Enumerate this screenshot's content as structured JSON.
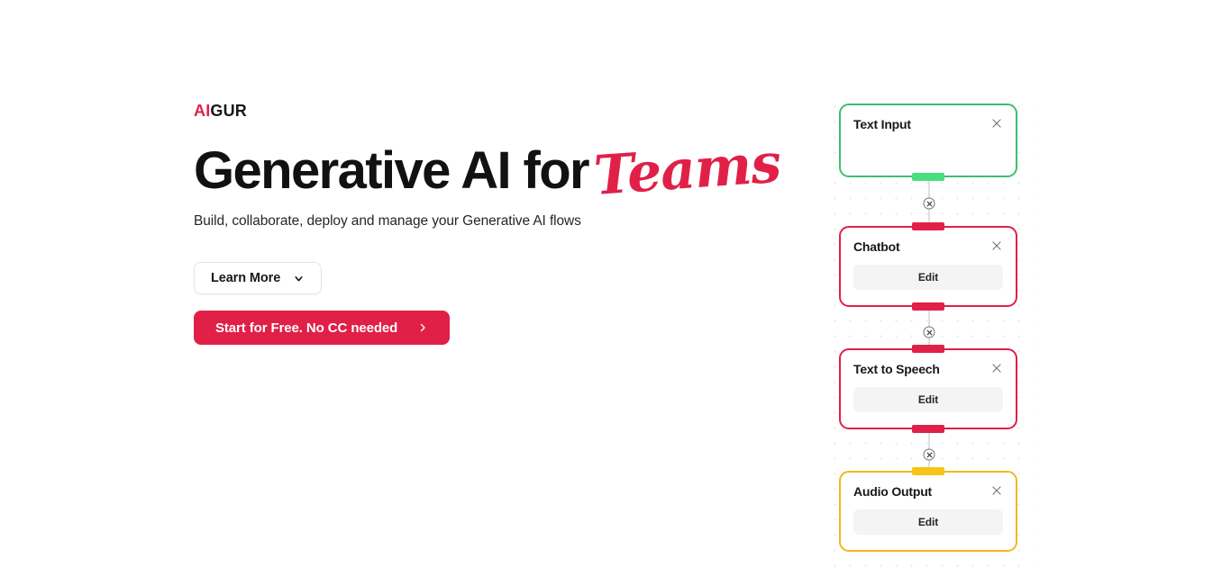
{
  "brand": {
    "logo_ai": "AI",
    "logo_gur": "GUR",
    "accent_color": "#E12048",
    "text_color": "#18181B"
  },
  "hero": {
    "headline_plain": "Generative AI for",
    "headline_script": "Teams",
    "subheadline": "Build, collaborate, deploy and manage your Generative AI flows",
    "learn_more_label": "Learn More",
    "learn_more_icon": "chevron-down-icon",
    "cta_label": "Start for Free. No CC needed",
    "cta_icon": "chevron-right-icon"
  },
  "flow": {
    "edit_label": "Edit",
    "close_icon": "close-icon",
    "edge_delete_icon": "circle-x-icon",
    "nodes": [
      {
        "title": "Text Input",
        "border_color": "#3FBE6E",
        "output_handle_color": "#4ADE80",
        "has_edit": false
      },
      {
        "title": "Chatbot",
        "border_color": "#E12048",
        "input_handle_color": "#E12048",
        "output_handle_color": "#E12048",
        "has_edit": true
      },
      {
        "title": "Text to Speech",
        "border_color": "#E12048",
        "input_handle_color": "#E12048",
        "output_handle_color": "#E12048",
        "has_edit": true
      },
      {
        "title": "Audio Output",
        "border_color": "#EFB920",
        "input_handle_color": "#F5C518",
        "has_edit": true
      }
    ]
  }
}
